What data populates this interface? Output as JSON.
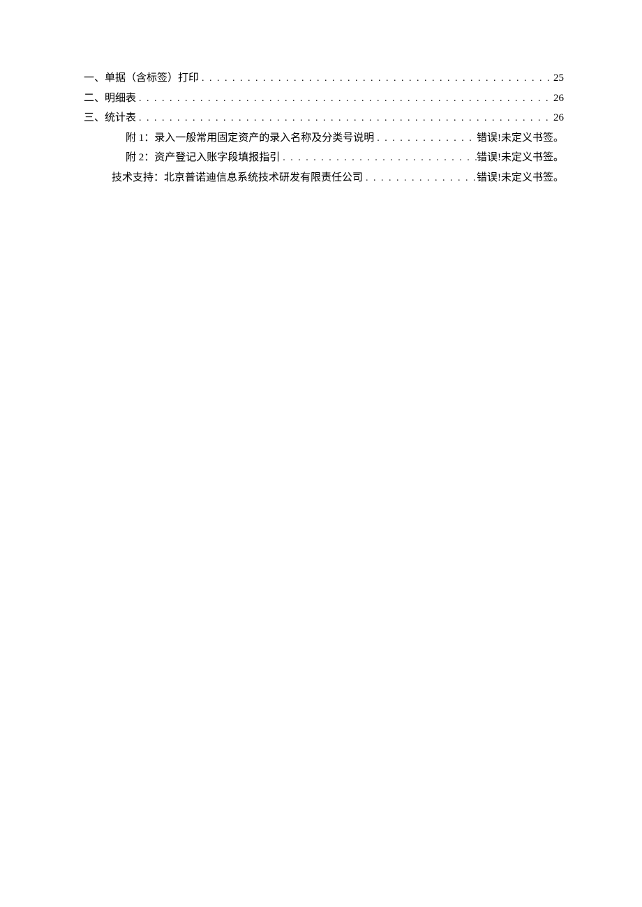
{
  "toc": {
    "entries": [
      {
        "label": "一、单据（含标签）打印",
        "page": "25",
        "indent": 0
      },
      {
        "label": "二、明细表",
        "page": "26",
        "indent": 0
      },
      {
        "label": "三、统计表",
        "page": "26",
        "indent": 0
      },
      {
        "label": "附 1：录入一般常用固定资产的录入名称及分类号说明",
        "page": "错误!未定义书签。",
        "indent": 1
      },
      {
        "label": "附 2：资产登记入账字段填报指引",
        "page": "错误!未定义书签。",
        "indent": 1
      },
      {
        "label": "技术支持：北京普诺迪信息系统技术研发有限责任公司",
        "page": "错误!未定义书签。",
        "indent": 2
      }
    ]
  }
}
